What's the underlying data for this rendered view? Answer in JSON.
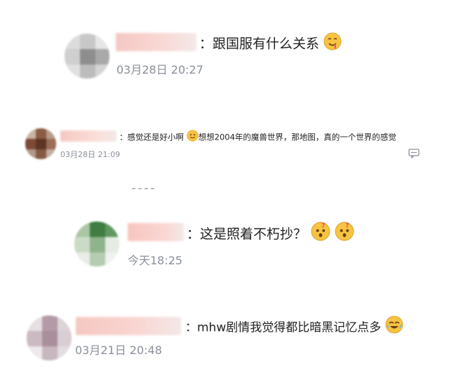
{
  "comments": [
    {
      "separator": "：",
      "text": "跟国服有什么关系",
      "time": "03月28日 20:27",
      "emoji": "drooling-face-emoji"
    },
    {
      "separator": "：",
      "text_part1": "感觉还是好小啊",
      "text_part2": "想想2004年的魔兽世界，那地图，真的一个世界的感觉",
      "time": "03月28日 21:09",
      "emoji": "smile-face-emoji"
    },
    {
      "separator": "：",
      "text": "这是照着不朽抄？",
      "time": "今天18:25",
      "emoji": "confused-face-emoji"
    },
    {
      "separator": "：",
      "text": "mhw剧情我觉得都比暗黑记忆点多",
      "time": "03月21日 20:48",
      "emoji": "laughing-tears-emoji"
    }
  ],
  "icons": {
    "reply": "reply-icon"
  },
  "colors": {
    "text": "#222222",
    "time": "#8a8f99",
    "emoji_yellow": "#f6c343",
    "name_blur": "#f7c4bf"
  }
}
